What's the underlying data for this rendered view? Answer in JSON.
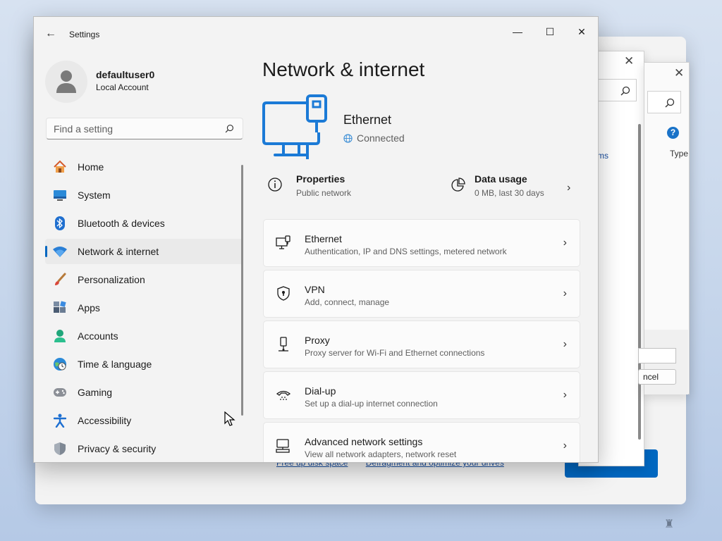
{
  "window": {
    "title": "Settings",
    "back": "←",
    "minimize": "—",
    "maximize": "☐",
    "close": "✕"
  },
  "profile": {
    "name": "defaultuser0",
    "account_type": "Local Account"
  },
  "search": {
    "placeholder": "Find a setting"
  },
  "sidebar": {
    "items": [
      {
        "label": "Home",
        "icon": "home-icon"
      },
      {
        "label": "System",
        "icon": "system-icon"
      },
      {
        "label": "Bluetooth & devices",
        "icon": "bluetooth-icon"
      },
      {
        "label": "Network & internet",
        "icon": "wifi-icon",
        "selected": true
      },
      {
        "label": "Personalization",
        "icon": "brush-icon"
      },
      {
        "label": "Apps",
        "icon": "apps-icon"
      },
      {
        "label": "Accounts",
        "icon": "accounts-icon"
      },
      {
        "label": "Time & language",
        "icon": "globe-clock-icon"
      },
      {
        "label": "Gaming",
        "icon": "gamepad-icon"
      },
      {
        "label": "Accessibility",
        "icon": "accessibility-icon"
      },
      {
        "label": "Privacy & security",
        "icon": "shield-icon"
      }
    ]
  },
  "main": {
    "title": "Network & internet",
    "hero": {
      "name": "Ethernet",
      "status": "Connected"
    },
    "properties": {
      "title": "Properties",
      "subtitle": "Public network"
    },
    "data_usage": {
      "title": "Data usage",
      "subtitle": "0 MB, last 30 days"
    },
    "cards": [
      {
        "title": "Ethernet",
        "subtitle": "Authentication, IP and DNS settings, metered network",
        "icon": "ethernet-icon"
      },
      {
        "title": "VPN",
        "subtitle": "Add, connect, manage",
        "icon": "vpn-shield-icon"
      },
      {
        "title": "Proxy",
        "subtitle": "Proxy server for Wi-Fi and Ethernet connections",
        "icon": "proxy-icon"
      },
      {
        "title": "Dial-up",
        "subtitle": "Set up a dial-up internet connection",
        "icon": "phone-icon"
      },
      {
        "title": "Advanced network settings",
        "subtitle": "View all network adapters, network reset",
        "icon": "monitor-network-icon"
      }
    ]
  },
  "background": {
    "links": [
      "Free up disk space",
      "Defragment and optimize your drives"
    ],
    "partial_link": "ms",
    "column_header": "Type",
    "cancel_partial": "ncel",
    "help": "?"
  },
  "colors": {
    "accent": "#0067c0",
    "window_bg": "#f3f3f3",
    "card_bg": "#fbfbfb"
  }
}
